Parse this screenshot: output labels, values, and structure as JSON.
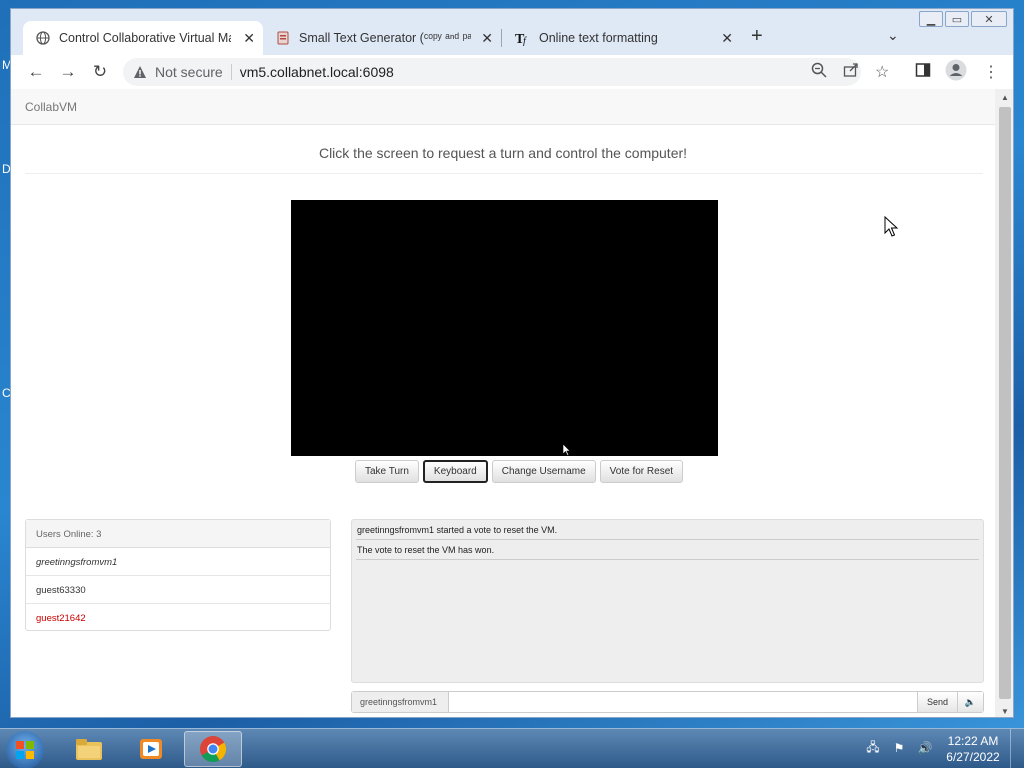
{
  "desktop": {
    "edge_letters": [
      "M",
      "D",
      "C"
    ]
  },
  "browser": {
    "tabs": [
      {
        "title": "Control Collaborative Virtual Ma",
        "favicon": "globe-icon",
        "active": true
      },
      {
        "title": "Small Text Generator (ᶜᵒᵖʸ ᵃⁿᵈ ᵖᵃˢᵗᵉ)",
        "favicon": "text-generator-icon",
        "active": false
      },
      {
        "title": "Online text formatting",
        "favicon": "tf-icon",
        "active": false
      }
    ],
    "address": {
      "security_label": "Not secure",
      "url": "vm5.collabnet.local:6098"
    }
  },
  "page": {
    "brand": "CollabVM",
    "instruction": "Click the screen to request a turn and control the computer!",
    "vm_buttons": {
      "take_turn": "Take Turn",
      "keyboard": "Keyboard",
      "change_username": "Change Username",
      "vote_reset": "Vote for Reset"
    },
    "users": {
      "header": "Users Online: 3",
      "list": [
        "greetinngsfromvm1",
        "guest63330",
        "guest21642"
      ]
    },
    "chat": {
      "messages": [
        "greetinngsfromvm1 started a vote to reset the VM.",
        "The vote to reset the VM has won."
      ],
      "username": "greetinngsfromvm1",
      "input_value": "",
      "send_label": "Send"
    }
  },
  "taskbar": {
    "time": "12:22 AM",
    "date": "6/27/2022"
  }
}
